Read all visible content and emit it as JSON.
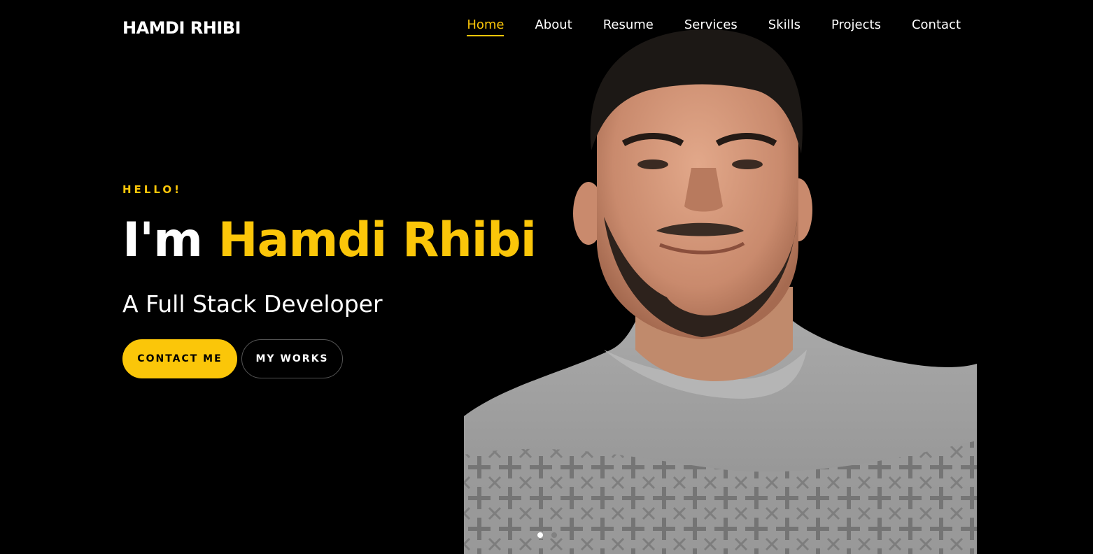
{
  "brand": "HAMDI RHIBI",
  "nav": [
    {
      "label": "Home",
      "active": true
    },
    {
      "label": "About",
      "active": false
    },
    {
      "label": "Resume",
      "active": false
    },
    {
      "label": "Services",
      "active": false
    },
    {
      "label": "Skills",
      "active": false
    },
    {
      "label": "Projects",
      "active": false
    },
    {
      "label": "Contact",
      "active": false
    }
  ],
  "hero": {
    "subheading": "HELLO!",
    "heading_prefix": "I'm ",
    "heading_name": "Hamdi Rhibi",
    "role": "A Full Stack Developer",
    "primary_button": "CONTACT ME",
    "secondary_button": "MY WORKS"
  },
  "carousel": {
    "slide_count": 2,
    "active_index": 0
  },
  "colors": {
    "accent": "#fbc609",
    "background": "#000000",
    "text": "#ffffff"
  }
}
